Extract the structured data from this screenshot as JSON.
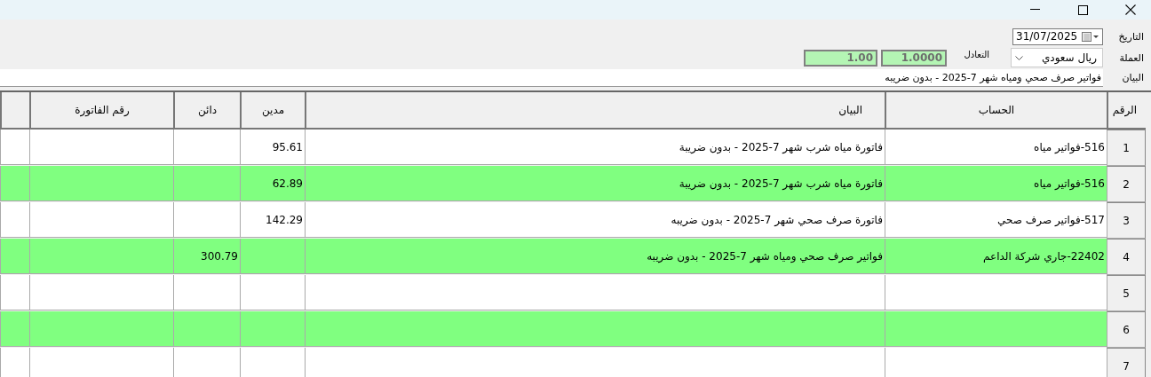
{
  "form": {
    "date_label": "التاريخ",
    "date": "31/07/2025",
    "currency_label": "العملة",
    "currency": "ريال سعودي",
    "rate_label": "التعادل",
    "rate": "1.0000",
    "rate_2": "1.00",
    "description_label": "البيان",
    "description": "فواتير صرف صحي ومياه شهر 7-2025 - بدون ضريبه"
  },
  "table": {
    "columns": [
      "الرقم",
      "الحساب",
      "البيان",
      "مدين",
      "دائن",
      "رقم الفاتورة"
    ],
    "rows": [
      {
        "number": "1",
        "account": "516-فواتير مياه",
        "description": "فاتورة مياه شرب شهر 7-2025 - بدون ضريبة",
        "debit": "95.61",
        "credit": "",
        "invoice": "",
        "highlighted": false
      },
      {
        "number": "2",
        "account": "516-فواتير مياه",
        "description": "فاتورة مياه شرب شهر 7-2025 - بدون ضريبة",
        "debit": "62.89",
        "credit": "",
        "invoice": "",
        "highlighted": true
      },
      {
        "number": "3",
        "account": "517-فواتير صرف صحي",
        "description": "فاتورة صرف صحي شهر 7-2025 - بدون ضريبه",
        "debit": "142.29",
        "credit": "",
        "invoice": "",
        "highlighted": false
      },
      {
        "number": "4",
        "account": "22402-جاري شركة الداعم",
        "description": "فواتير صرف صحي ومياه شهر 7-2025 - بدون ضريبه",
        "debit": "",
        "credit": "300.79",
        "invoice": "",
        "highlighted": true
      },
      {
        "number": "5",
        "account": "",
        "description": "",
        "debit": "",
        "credit": "",
        "invoice": "",
        "highlighted": false
      },
      {
        "number": "6",
        "account": "",
        "description": "",
        "debit": "",
        "credit": "",
        "invoice": "",
        "highlighted": true
      },
      {
        "number": "7",
        "account": "",
        "description": "",
        "debit": "",
        "credit": "",
        "invoice": "",
        "highlighted": false
      }
    ]
  }
}
